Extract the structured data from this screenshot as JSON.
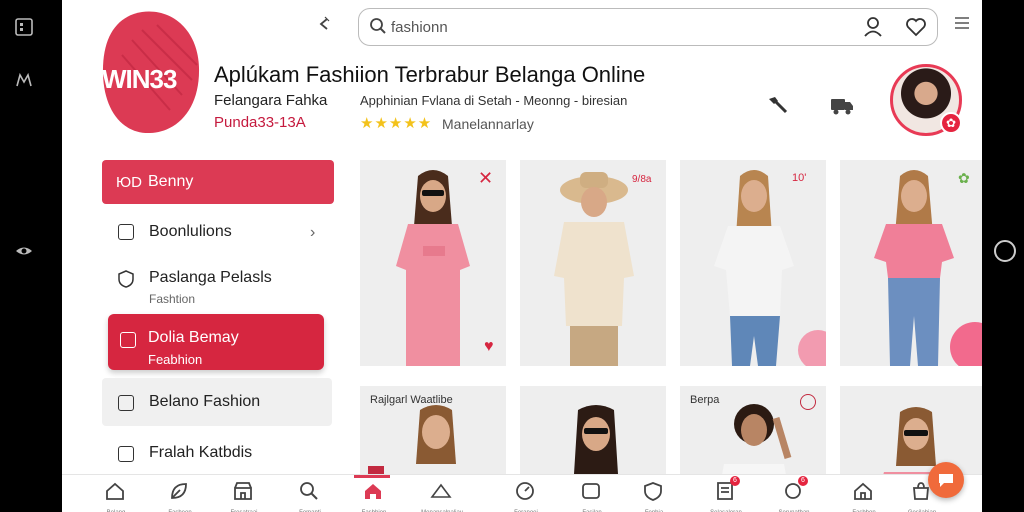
{
  "app": {
    "logo_text": "WIN33",
    "title": "Aplúkam Fashiion Terbrabur Belanga Online",
    "subtitle_line1": "Felangara Fahka",
    "subtitle_line2": "Punda33-13A",
    "tagline": "Apphinian Fvlana di Setah - Meonng - biresian",
    "rating_stars": "★★★★★",
    "reviews_text": "Manelannarlay",
    "brand_color": "#dc3a54"
  },
  "search": {
    "value": "fashionn",
    "placeholder": "fashionn"
  },
  "sidebar": {
    "items": [
      {
        "icon_text": "ЮD",
        "label": "Benny"
      },
      {
        "label": "Boonlulions",
        "chevron": "›"
      },
      {
        "label": "Paslanga Pelasls",
        "sub": "Fashtion"
      },
      {
        "label": "Dolia Bemay",
        "sub": "Feabhion"
      },
      {
        "label": "Belano Fashion"
      },
      {
        "label": "Fralah Katbdis"
      }
    ]
  },
  "products": {
    "row1": [
      {
        "mark": "✕"
      },
      {
        "mark": "9/8a"
      },
      {
        "mark": "10'"
      },
      {
        "mark": ""
      }
    ],
    "row2": [
      {
        "label": "Rajlgarl Waatlibe"
      },
      {
        "label": ""
      },
      {
        "label": "Berpa"
      },
      {
        "label": ""
      }
    ]
  },
  "bottom_nav": {
    "items": [
      {
        "icon": "home-icon",
        "label": "Belang"
      },
      {
        "icon": "leaf-icon",
        "label": "Fasheon"
      },
      {
        "icon": "store-icon",
        "label": "Fresatraai"
      },
      {
        "icon": "search-icon",
        "label": "Femanti"
      },
      {
        "icon": "home-filled-icon",
        "label": "Fasbhion"
      },
      {
        "icon": "hanger-icon",
        "label": "Menansalnaliay"
      },
      {
        "icon": "dial-icon",
        "label": "Feranoei"
      },
      {
        "icon": "message-icon",
        "label": "Fasilan"
      },
      {
        "icon": "shield-icon",
        "label": "Fenbia"
      },
      {
        "icon": "receipt-icon",
        "label": "Selasaleran",
        "badge": "6"
      },
      {
        "icon": "chat-icon",
        "label": "Serunatban",
        "badge": "6"
      },
      {
        "icon": "house-outline-icon",
        "label": "Fasbhon"
      },
      {
        "icon": "bag-icon",
        "label": "Gesilahian"
      }
    ]
  }
}
